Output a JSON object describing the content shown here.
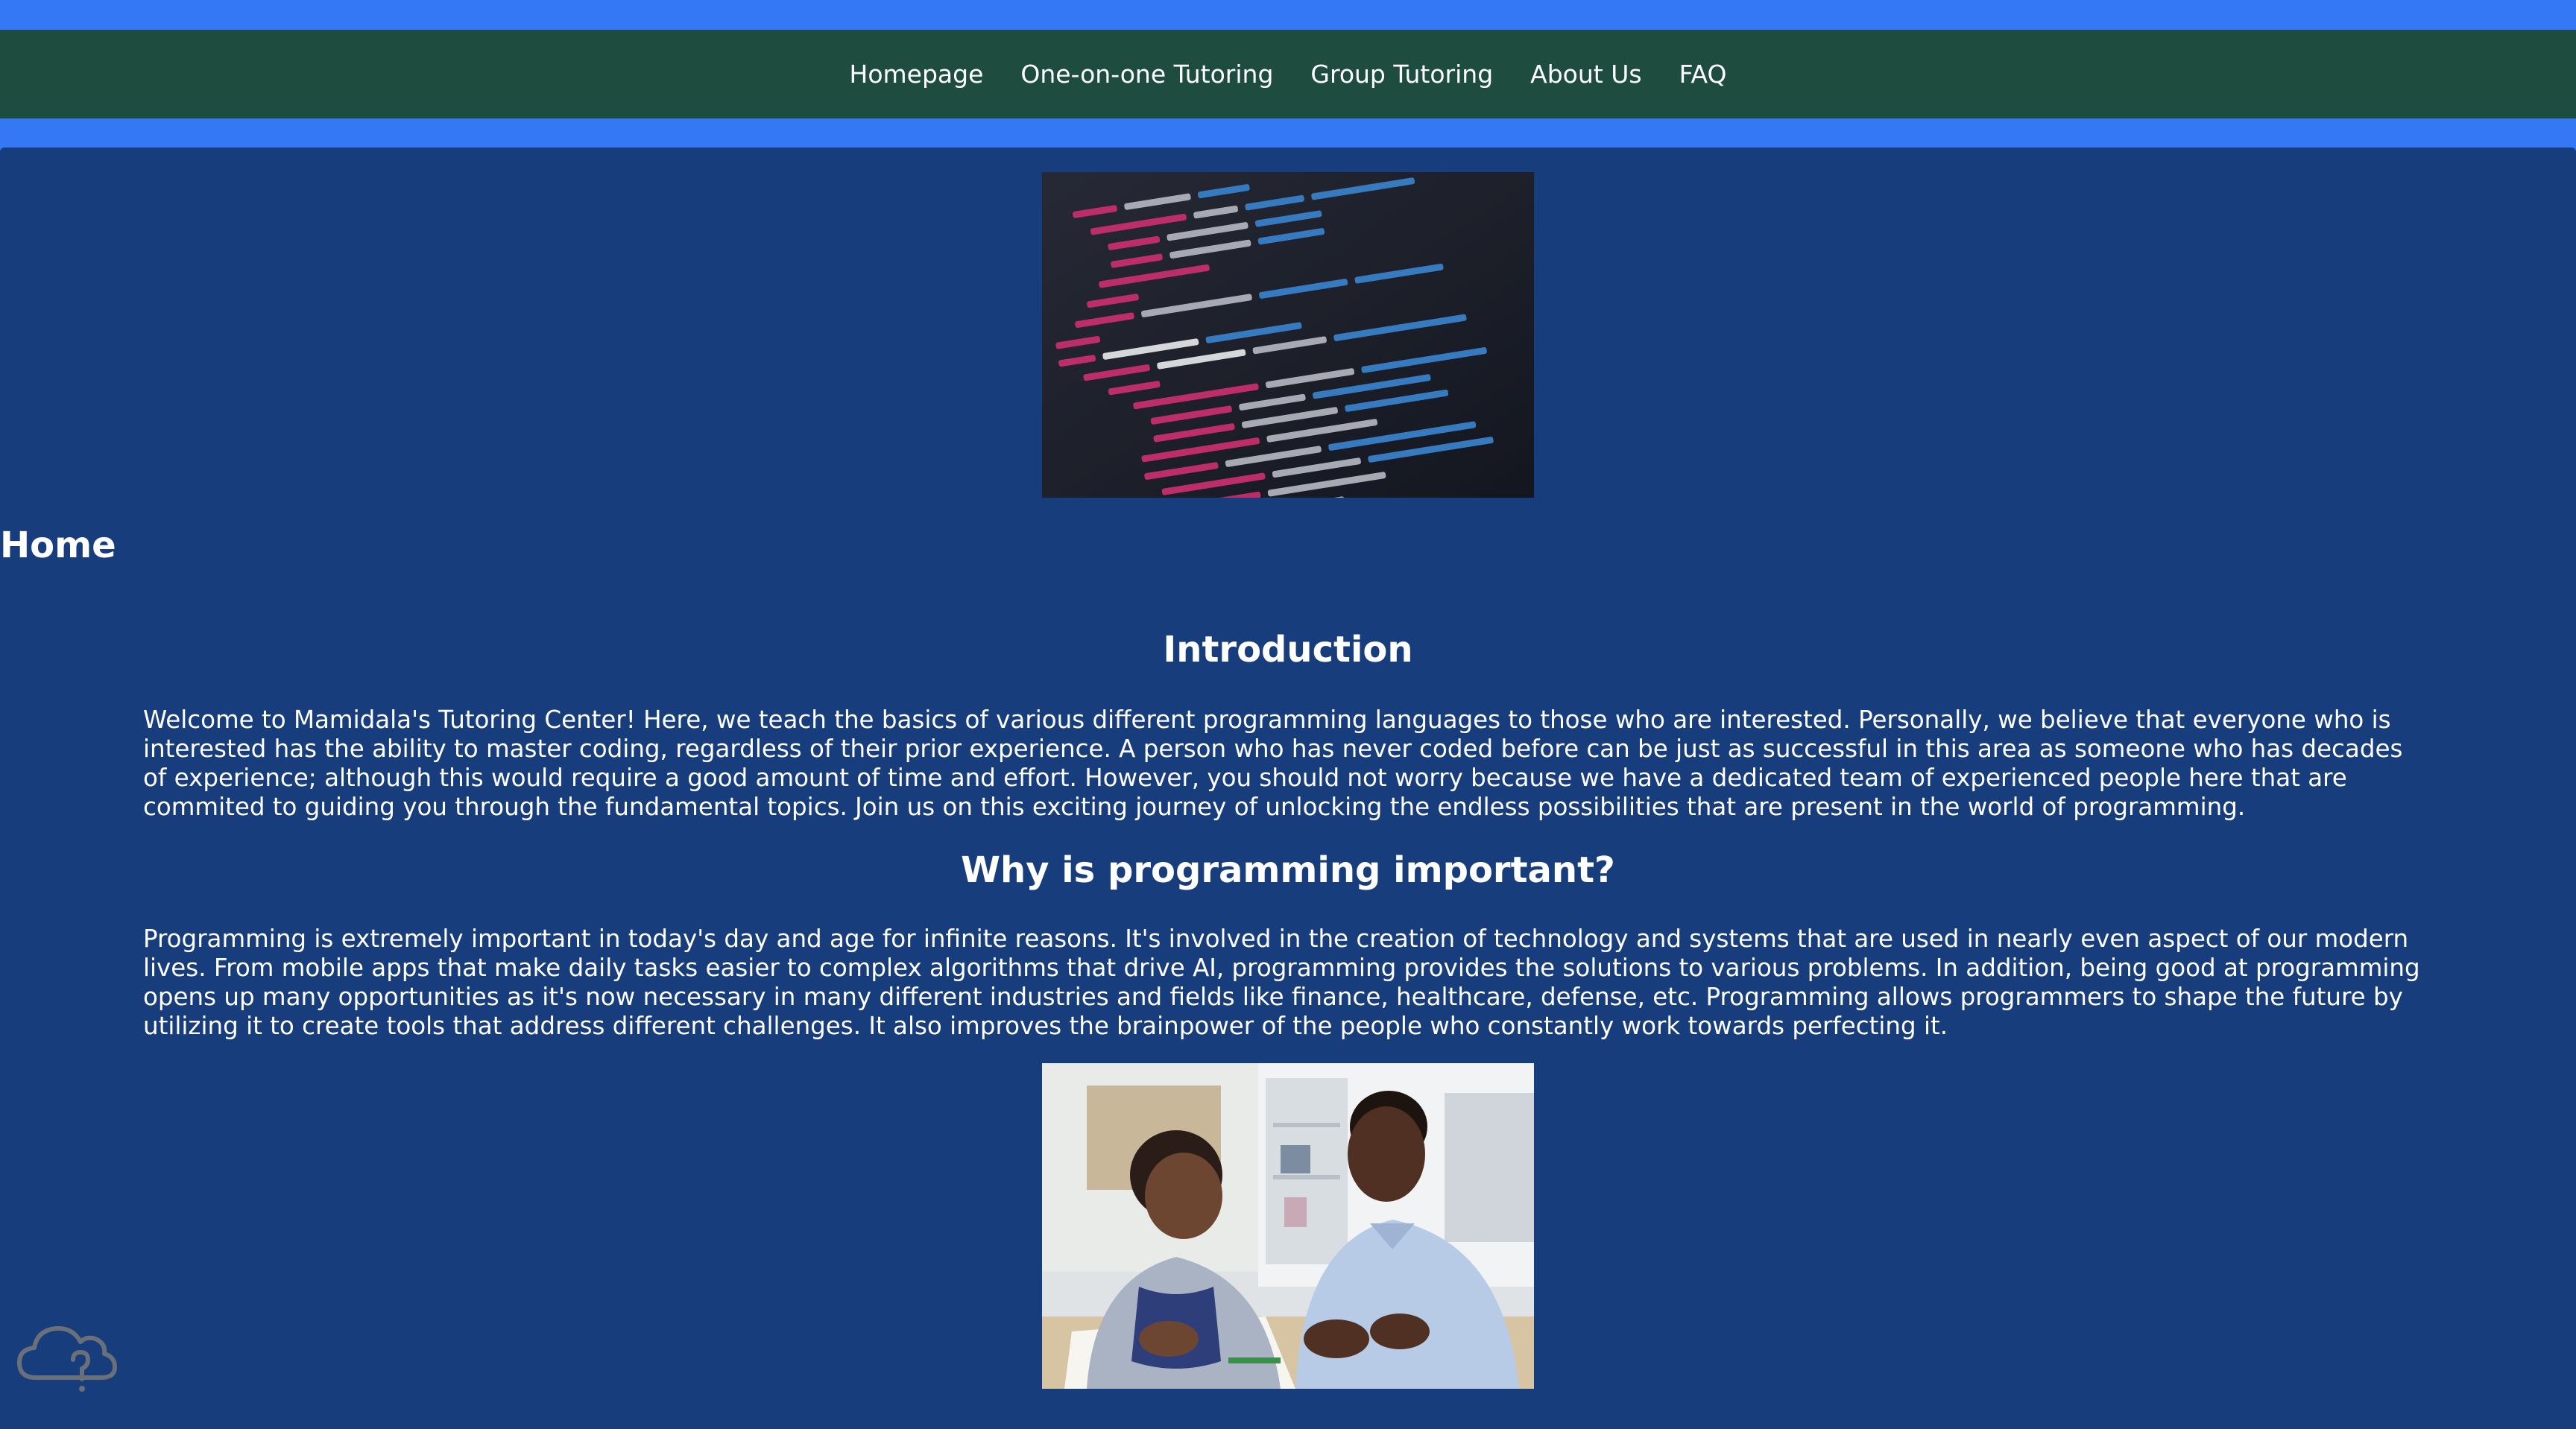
{
  "nav": {
    "items": [
      {
        "label": "Homepage"
      },
      {
        "label": "One-on-one Tutoring"
      },
      {
        "label": "Group Tutoring"
      },
      {
        "label": "About Us"
      },
      {
        "label": "FAQ"
      }
    ]
  },
  "main": {
    "heading": "Home",
    "sections": [
      {
        "title": "Introduction",
        "body": "Welcome to Mamidala's Tutoring Center! Here, we teach the basics of various different programming languages to those who are interested. Personally, we believe that everyone who is interested has the ability to master coding, regardless of their prior experience. A person who has never coded before can be just as successful in this area as someone who has decades of experience; although this would require a good amount of time and effort. However, you should not worry because we have a dedicated team of experienced people here that are commited to guiding you through the fundamental topics. Join us on this exciting journey of unlocking the endless possibilities that are present in the world of programming."
      },
      {
        "title": "Why is programming important?",
        "body": "Programming is extremely important in today's day and age for infinite reasons. It's involved in the creation of technology and systems that are used in nearly even aspect of our modern lives. From mobile apps that make daily tasks easier to complex algorithms that drive AI, programming provides the solutions to various problems. In addition, being good at programming opens up many opportunities as it's now necessary in many different industries and fields like finance, healthcare, defense, etc. Programming allows programmers to shape the future by utilizing it to create tools that address different challenges. It also improves the brainpower of the people who constantly work towards perfecting it."
      }
    ],
    "next_section_peek": ""
  },
  "images": {
    "code_image": "code-screenshot-image",
    "tutoring_image": "tutoring-photo-image"
  },
  "icons": {
    "help": "cloud-question-icon"
  },
  "colors": {
    "top_band": "#3478f6",
    "nav_background": "#1e4d3f",
    "content_background": "#183d7d",
    "text": "#ffffff"
  }
}
